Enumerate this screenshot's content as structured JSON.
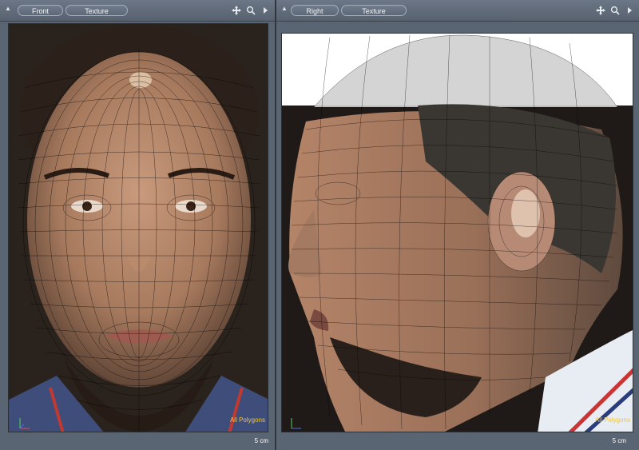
{
  "viewports": [
    {
      "view_label": "Front",
      "shading_label": "Texture",
      "overlay_label": "All Polygons",
      "scale_label": "5 cm"
    },
    {
      "view_label": "Right",
      "shading_label": "Texture",
      "overlay_label": "All Polygons",
      "scale_label": "5 cm"
    }
  ],
  "icons": [
    "collapse-arrow-icon",
    "move-icon",
    "zoom-icon",
    "maximize-arrow-icon",
    "axis-gizmo-icon"
  ],
  "colors": {
    "panel": "#5a6574",
    "header": "#6b7686",
    "overlay_text": "#f2c63a",
    "wireframe": "#000000"
  }
}
